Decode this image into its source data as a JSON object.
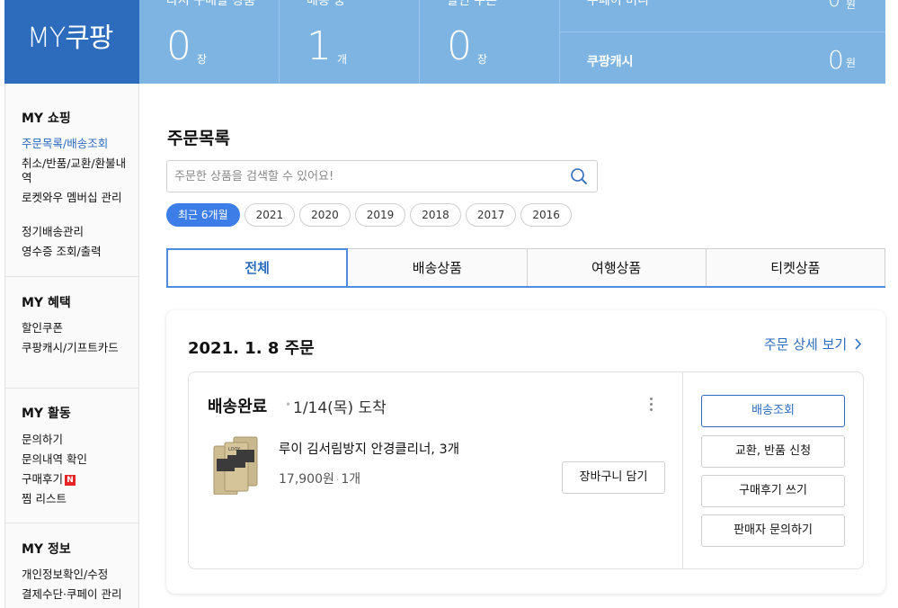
{
  "logo": {
    "text": "MY쿠팡"
  },
  "stats": [
    {
      "label": "다시 구매할 상품",
      "value": "0",
      "unit": "장"
    },
    {
      "label": "배송 중",
      "value": "1",
      "unit": "개"
    },
    {
      "label": "할인 쿠폰",
      "value": "0",
      "unit": "장"
    }
  ],
  "cash_top": {
    "label": "쿠페이 머니",
    "value": "0",
    "unit": "원"
  },
  "cash": {
    "label": "쿠팡캐시",
    "value": "0",
    "unit": "원"
  },
  "sidebar": {
    "shopping": {
      "title": "MY 쇼핑",
      "items": [
        "주문목록/배송조회",
        "취소/반품/교환/환불내역",
        "로켓와우 멤버십 관리",
        "정기배송관리",
        "영수증 조회/출력"
      ]
    },
    "benefits": {
      "title": "MY 혜택",
      "items": [
        "할인쿠폰",
        "쿠팡캐시/기프트카드"
      ]
    },
    "activity": {
      "title": "MY 활동",
      "items": [
        "문의하기",
        "문의내역 확인",
        "구매후기",
        "찜 리스트"
      ],
      "new_badge": "N"
    },
    "info": {
      "title": "MY 정보",
      "items": [
        "개인정보확인/수정",
        "결제수단·쿠페이 관리"
      ]
    }
  },
  "main": {
    "title": "주문목록",
    "search": {
      "placeholder": "주문한 상품을 검색할 수 있어요!",
      "value": ""
    },
    "periods": [
      "최근 6개월",
      "2021",
      "2020",
      "2019",
      "2018",
      "2017",
      "2016"
    ],
    "active_period": "최근 6개월",
    "tabs": [
      "전체",
      "배송상품",
      "여행상품",
      "티켓상품"
    ],
    "active_tab": "전체"
  },
  "order": {
    "date_title": "2021. 1. 8 주문",
    "detail_link": "주문 상세 보기",
    "status": "배송완료",
    "arrival": "1/14(목) 도착",
    "item_name": "루이 김서림방지 안경클리너, 3개",
    "price": "17,900원",
    "quantity": "1개",
    "cart_button": "장바구니 담기",
    "actions": [
      "배송조회",
      "교환, 반품 신청",
      "구매후기 쓰기",
      "판매자 문의하기"
    ],
    "thumb_brand": "LOOY"
  },
  "colors": {
    "brand_blue": "#2d6bbd",
    "banner_blue": "#7eb4e2",
    "chip_active": "#3d7de8",
    "tab_border": "#4f8ce0",
    "new_badge": "#e52528"
  }
}
